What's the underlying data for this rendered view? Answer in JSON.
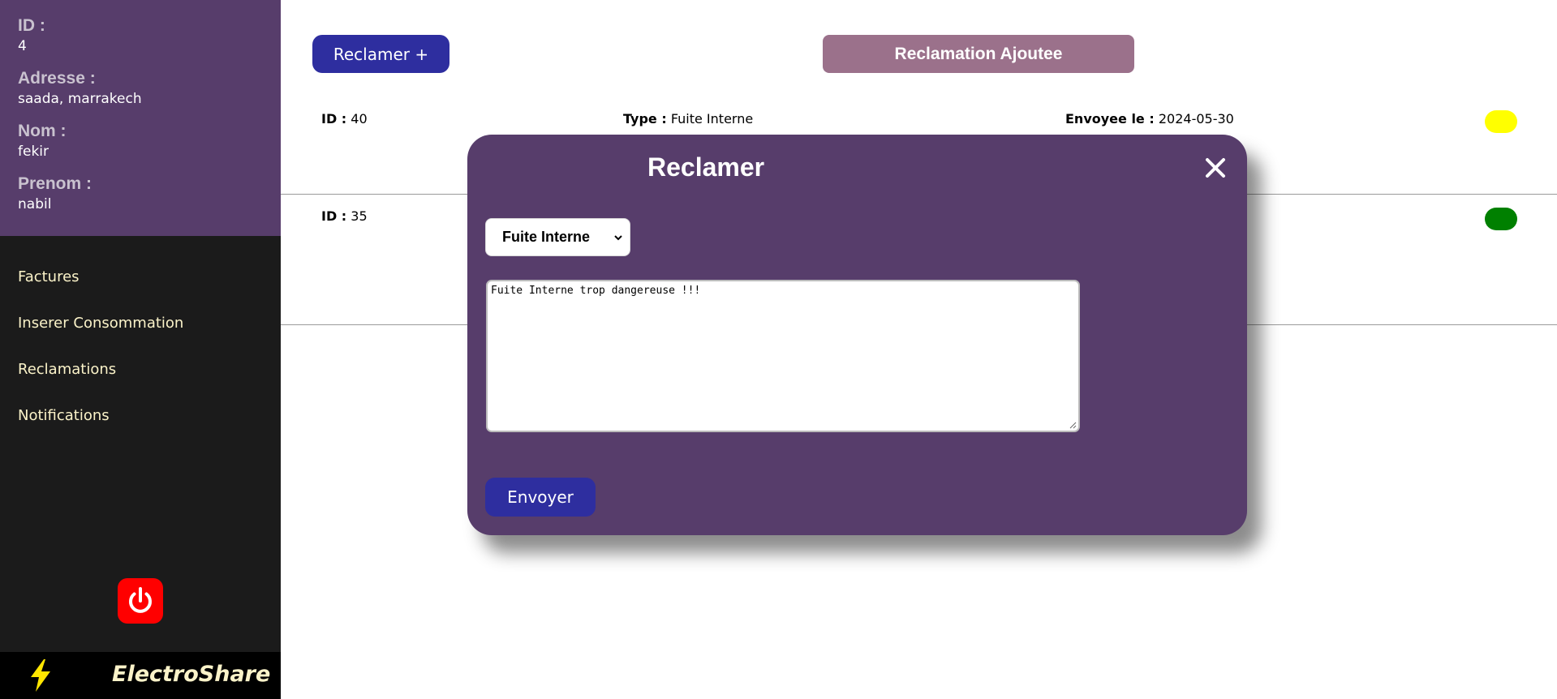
{
  "profile": {
    "id_label": "ID :",
    "id_value": "4",
    "address_label": "Adresse :",
    "address_value": "saada, marrakech",
    "lastname_label": "Nom :",
    "lastname_value": "fekir",
    "firstname_label": "Prenom :",
    "firstname_value": "nabil"
  },
  "nav": {
    "items": [
      {
        "label": "Factures"
      },
      {
        "label": "Inserer Consommation"
      },
      {
        "label": "Reclamations"
      },
      {
        "label": "Notifications"
      }
    ]
  },
  "icons": {
    "logout": "power-icon",
    "brand": "lightning-bolt-icon",
    "close": "close-icon",
    "select": "chevron-down-icon"
  },
  "brand": {
    "name": "ElectroShare"
  },
  "main": {
    "reclamer_button": "Reclamer +",
    "toast": "Reclamation Ajoutee",
    "rows": [
      {
        "id_label": "ID :",
        "id_value": "40",
        "type_label": "Type :",
        "type_value": "Fuite Interne",
        "date_label": "Envoyee le :",
        "date_value": "2024-05-30",
        "status_color": "#ffff00"
      },
      {
        "id_label": "ID :",
        "id_value": "35",
        "status_color": "#008000"
      }
    ]
  },
  "modal": {
    "title": "Reclamer",
    "type_selected": "Fuite Interne",
    "message_value": "Fuite Interne trop dangereuse !!!",
    "send_button": "Envoyer"
  },
  "colors": {
    "sidebar_profile_bg": "#573d6b",
    "sidebar_bg": "#1b1b1b",
    "primary_button": "#2e2e9f",
    "toast_bg": "#9b718b",
    "logout_red": "#ff0000"
  }
}
